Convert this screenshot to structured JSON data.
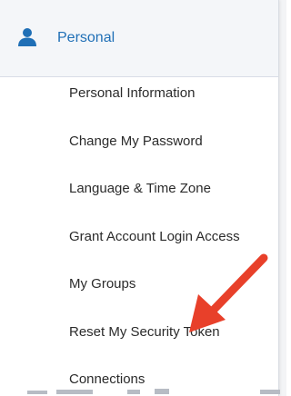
{
  "colors": {
    "accent": "#1f6fb6",
    "arrow": "#e8402a",
    "header_bg": "#f4f6f9",
    "text": "#2b2b2b"
  },
  "section": {
    "icon": "user-icon",
    "title": "Personal"
  },
  "menu": {
    "items": [
      {
        "label": "Personal Information"
      },
      {
        "label": "Change My Password"
      },
      {
        "label": "Language & Time Zone"
      },
      {
        "label": "Grant Account Login Access"
      },
      {
        "label": "My Groups"
      },
      {
        "label": "Reset My Security Token"
      },
      {
        "label": "Connections"
      }
    ]
  },
  "annotation": {
    "icon": "red-arrow-icon",
    "points_to": "Reset My Security Token"
  }
}
